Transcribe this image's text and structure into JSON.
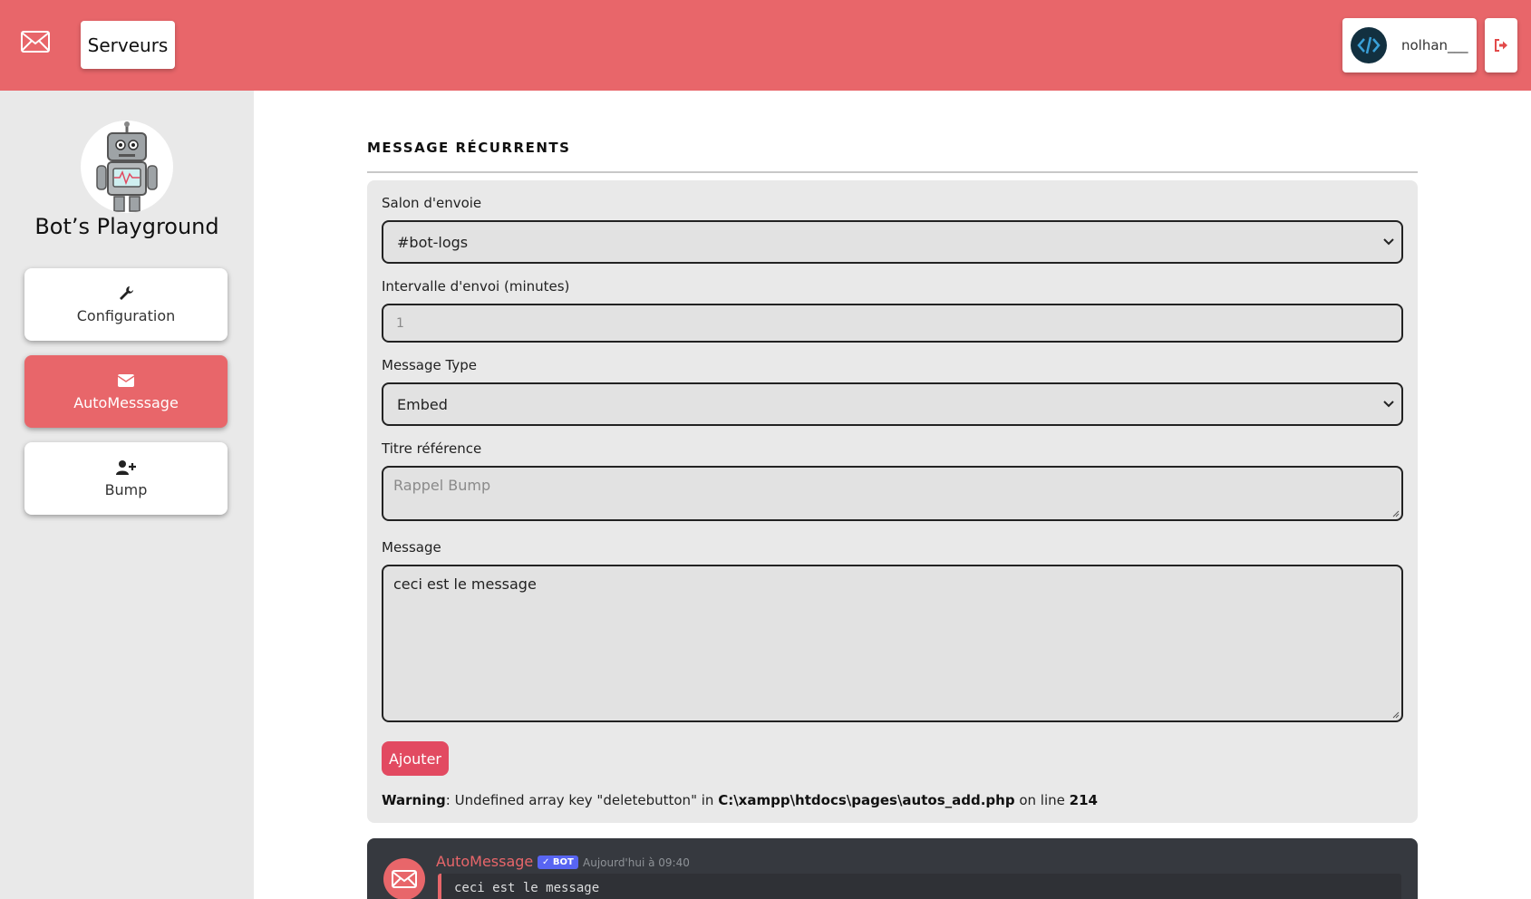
{
  "header": {
    "servers_label": "Serveurs",
    "username": "nolhan___",
    "accent_color": "#e8666a"
  },
  "sidebar": {
    "bot_name": "Bot’s Playground",
    "items": [
      {
        "label": "Configuration",
        "icon": "wrench-icon",
        "active": false
      },
      {
        "label": "AutoMesssage",
        "icon": "envelope-icon",
        "active": true
      },
      {
        "label": "Bump",
        "icon": "user-plus-icon",
        "active": false
      }
    ]
  },
  "main": {
    "section_title": "MESSAGE RÉCURRENTS",
    "form": {
      "channel_label": "Salon d'envoie",
      "channel_value": "#bot-logs",
      "interval_label": "Intervalle d'envoi (minutes)",
      "interval_placeholder": "1",
      "type_label": "Message Type",
      "type_value": "Embed",
      "title_label": "Titre référence",
      "title_placeholder": "Rappel Bump",
      "message_label": "Message",
      "message_value": "ceci est le message",
      "submit_label": "Ajouter"
    },
    "warning": {
      "prefix": "Warning",
      "text": ": Undefined array key \"deletebutton\" in ",
      "path": "C:\\xampp\\htdocs\\pages\\autos_add.php",
      "mid": " on line ",
      "line": "214"
    },
    "preview": {
      "author": "AutoMessage",
      "badge": "✓ BOT",
      "timestamp": "Aujourd'hui à 09:40",
      "content": "ceci est le message"
    }
  }
}
